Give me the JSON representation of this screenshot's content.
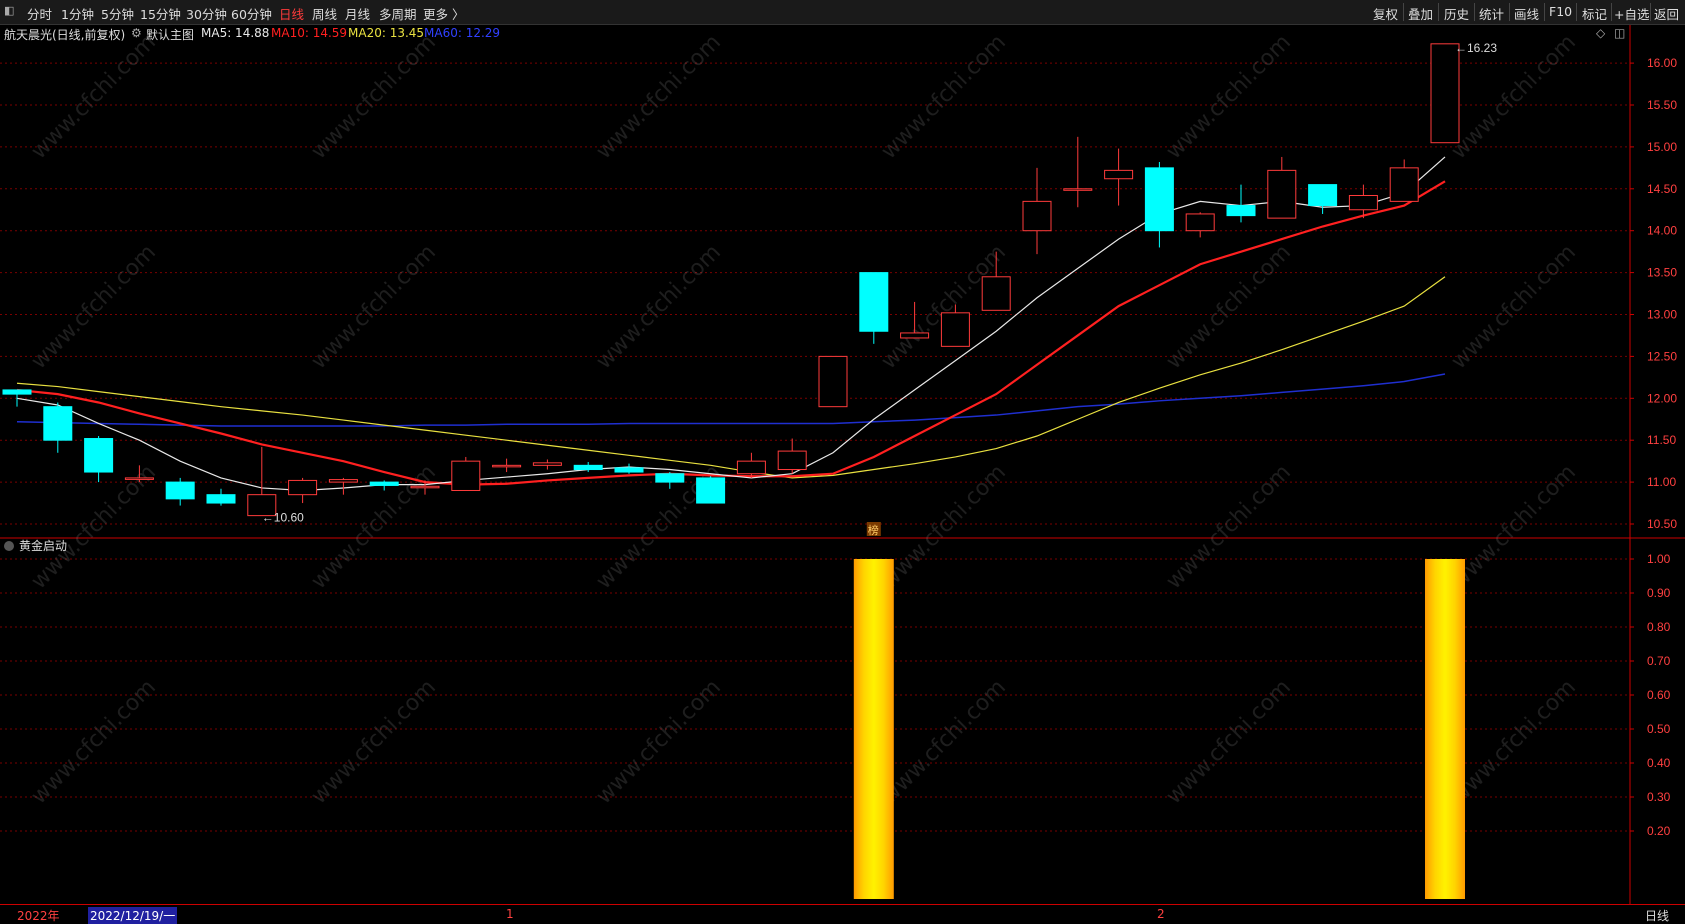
{
  "toolbar": {
    "periods": [
      "分时",
      "1分钟",
      "5分钟",
      "15分钟",
      "30分钟",
      "60分钟",
      "日线",
      "周线",
      "月线",
      "多周期",
      "更多 〉"
    ],
    "active_period": "日线",
    "right_items": [
      "复权",
      "叠加",
      "历史",
      "统计",
      "画线",
      "F10",
      "标记",
      "+自选",
      "返回"
    ]
  },
  "header": {
    "stock_title": "航天晨光(日线,前复权)",
    "chart_mode": "默认主图",
    "ma5_label": "MA5: 14.88",
    "ma10_label": "MA10: 14.59",
    "ma20_label": "MA20: 13.45",
    "ma60_label": "MA60: 12.29"
  },
  "colors": {
    "up": "#ff3b3b",
    "down": "#00ffff",
    "ma5": "#e8e8e8",
    "ma10": "#ff2020",
    "ma20": "#e8e040",
    "ma60": "#1f2fd0",
    "grid": "#7a0000",
    "axis_text": "#ff4040",
    "signal_bar": "#ffd000"
  },
  "main_panel": {
    "max_marker": "16.23",
    "min_marker": "10.60",
    "event_badge": "榜",
    "y_ticks": [
      "16.00",
      "15.50",
      "15.00",
      "14.50",
      "14.00",
      "13.50",
      "13.00",
      "12.50",
      "12.00",
      "11.50",
      "11.00",
      "10.50"
    ]
  },
  "indicator_panel": {
    "title": "黄金启动",
    "y_ticks": [
      "1.00",
      "0.90",
      "0.80",
      "0.70",
      "0.60",
      "0.50",
      "0.40",
      "0.30",
      "0.20"
    ]
  },
  "time_axis": {
    "year_label": "2022年",
    "cursor_date": "2022/12/19/一",
    "month_labels": [
      "1",
      "2"
    ],
    "period_label": "日线"
  },
  "watermark": "www.cfchi.com",
  "chart_data": {
    "type": "candlestick",
    "ylim": [
      10.4,
      16.3
    ],
    "candles": [
      {
        "o": 12.1,
        "c": 12.05,
        "h": 12.1,
        "l": 11.9
      },
      {
        "o": 11.9,
        "c": 11.5,
        "h": 11.95,
        "l": 11.35
      },
      {
        "o": 11.52,
        "c": 11.12,
        "h": 11.55,
        "l": 11.0
      },
      {
        "o": 11.05,
        "c": 11.05,
        "h": 11.2,
        "l": 11.0
      },
      {
        "o": 11.0,
        "c": 10.8,
        "h": 11.05,
        "l": 10.72
      },
      {
        "o": 10.85,
        "c": 10.75,
        "h": 10.92,
        "l": 10.72
      },
      {
        "o": 10.6,
        "c": 10.85,
        "h": 11.42,
        "l": 10.6
      },
      {
        "o": 10.85,
        "c": 11.02,
        "h": 11.05,
        "l": 10.75
      },
      {
        "o": 11.0,
        "c": 11.03,
        "h": 11.05,
        "l": 10.85
      },
      {
        "o": 11.0,
        "c": 10.96,
        "h": 11.02,
        "l": 10.9
      },
      {
        "o": 10.95,
        "c": 10.95,
        "h": 11.02,
        "l": 10.85
      },
      {
        "o": 10.9,
        "c": 11.25,
        "h": 11.3,
        "l": 10.9
      },
      {
        "o": 11.2,
        "c": 11.2,
        "h": 11.28,
        "l": 11.12
      },
      {
        "o": 11.2,
        "c": 11.23,
        "h": 11.27,
        "l": 11.15
      },
      {
        "o": 11.2,
        "c": 11.15,
        "h": 11.24,
        "l": 11.12
      },
      {
        "o": 11.17,
        "c": 11.12,
        "h": 11.22,
        "l": 11.1
      },
      {
        "o": 11.1,
        "c": 11.0,
        "h": 11.12,
        "l": 10.92
      },
      {
        "o": 11.05,
        "c": 10.75,
        "h": 11.07,
        "l": 10.75
      },
      {
        "o": 11.1,
        "c": 11.25,
        "h": 11.35,
        "l": 11.05
      },
      {
        "o": 11.15,
        "c": 11.37,
        "h": 11.52,
        "l": 11.1
      },
      {
        "o": 11.9,
        "c": 12.5,
        "h": 12.5,
        "l": 11.9
      },
      {
        "o": 13.5,
        "c": 12.8,
        "h": 13.5,
        "l": 12.65
      },
      {
        "o": 12.72,
        "c": 12.78,
        "h": 13.15,
        "l": 12.72
      },
      {
        "o": 12.62,
        "c": 13.02,
        "h": 13.12,
        "l": 12.62
      },
      {
        "o": 13.05,
        "c": 13.45,
        "h": 13.75,
        "l": 13.05
      },
      {
        "o": 14.0,
        "c": 14.35,
        "h": 14.75,
        "l": 13.72
      },
      {
        "o": 14.5,
        "c": 14.5,
        "h": 15.12,
        "l": 14.28
      },
      {
        "o": 14.62,
        "c": 14.72,
        "h": 14.98,
        "l": 14.3
      },
      {
        "o": 14.75,
        "c": 14.0,
        "h": 14.82,
        "l": 13.8
      },
      {
        "o": 14.0,
        "c": 14.2,
        "h": 14.22,
        "l": 13.92
      },
      {
        "o": 14.3,
        "c": 14.18,
        "h": 14.55,
        "l": 14.1
      },
      {
        "o": 14.15,
        "c": 14.72,
        "h": 14.88,
        "l": 14.15
      },
      {
        "o": 14.55,
        "c": 14.3,
        "h": 14.55,
        "l": 14.2
      },
      {
        "o": 14.25,
        "c": 14.42,
        "h": 14.55,
        "l": 14.15
      },
      {
        "o": 14.35,
        "c": 14.75,
        "h": 14.85,
        "l": 14.35
      },
      {
        "o": 15.05,
        "c": 16.23,
        "h": 16.23,
        "l": 15.05
      }
    ],
    "ma5": [
      12.0,
      11.92,
      11.7,
      11.5,
      11.25,
      11.05,
      10.93,
      10.9,
      10.93,
      10.97,
      10.97,
      11.02,
      11.06,
      11.1,
      11.15,
      11.18,
      11.15,
      11.1,
      11.05,
      11.1,
      11.35,
      11.75,
      12.1,
      12.45,
      12.8,
      13.2,
      13.55,
      13.9,
      14.2,
      14.35,
      14.3,
      14.35,
      14.28,
      14.3,
      14.45,
      14.88
    ],
    "ma10": [
      12.1,
      12.05,
      11.95,
      11.82,
      11.7,
      11.58,
      11.45,
      11.35,
      11.25,
      11.12,
      11.0,
      10.97,
      10.98,
      11.02,
      11.05,
      11.08,
      11.1,
      11.08,
      11.07,
      11.07,
      11.1,
      11.3,
      11.55,
      11.8,
      12.05,
      12.4,
      12.75,
      13.1,
      13.35,
      13.6,
      13.75,
      13.9,
      14.05,
      14.18,
      14.3,
      14.59
    ],
    "ma20": [
      12.18,
      12.14,
      12.08,
      12.02,
      11.96,
      11.9,
      11.85,
      11.8,
      11.74,
      11.68,
      11.62,
      11.56,
      11.5,
      11.44,
      11.38,
      11.32,
      11.26,
      11.2,
      11.12,
      11.05,
      11.08,
      11.15,
      11.22,
      11.3,
      11.4,
      11.55,
      11.75,
      11.95,
      12.12,
      12.28,
      12.42,
      12.58,
      12.75,
      12.92,
      13.1,
      13.45
    ],
    "ma60": [
      11.72,
      11.71,
      11.7,
      11.69,
      11.68,
      11.67,
      11.67,
      11.67,
      11.67,
      11.67,
      11.68,
      11.68,
      11.69,
      11.69,
      11.69,
      11.7,
      11.7,
      11.7,
      11.7,
      11.7,
      11.7,
      11.72,
      11.74,
      11.77,
      11.8,
      11.85,
      11.9,
      11.93,
      11.97,
      12.0,
      12.03,
      12.07,
      12.11,
      12.15,
      12.2,
      12.29
    ],
    "signal": [
      0,
      0,
      0,
      0,
      0,
      0,
      0,
      0,
      0,
      0,
      0,
      0,
      0,
      0,
      0,
      0,
      0,
      0,
      0,
      0,
      0,
      1,
      0,
      0,
      0,
      0,
      0,
      0,
      0,
      0,
      0,
      0,
      0,
      0,
      0,
      1
    ],
    "signal_ylim": [
      0.1,
      1.0
    ]
  }
}
